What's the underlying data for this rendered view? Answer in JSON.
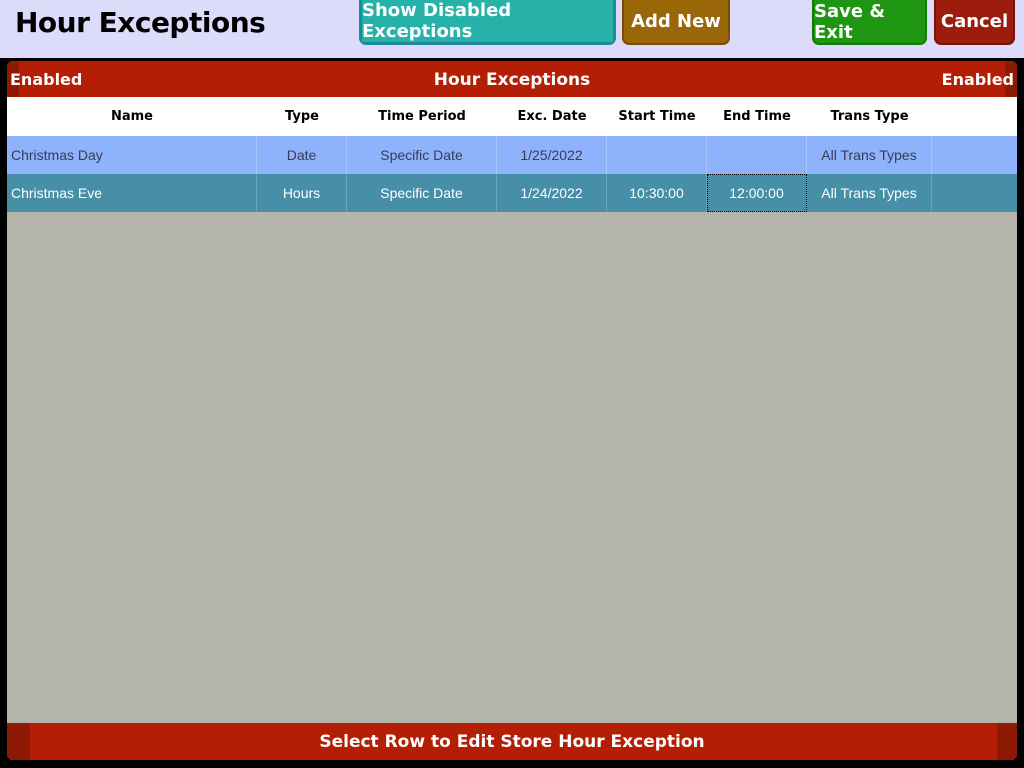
{
  "page_title": "Hour Exceptions",
  "toolbar": {
    "show_disabled_label": "Show Disabled Exceptions",
    "add_new_label": "Add New",
    "save_exit_label": "Save & Exit",
    "cancel_label": "Cancel"
  },
  "panel": {
    "title": "Hour Exceptions",
    "left_label": "Enabled",
    "right_label": "Enabled"
  },
  "table": {
    "columns": [
      "Name",
      "Type",
      "Time Period",
      "Exc. Date",
      "Start Time",
      "End Time",
      "Trans Type"
    ],
    "rows": [
      [
        "Christmas Day",
        "Date",
        "Specific Date",
        "1/25/2022",
        "",
        "",
        "All Trans Types"
      ],
      [
        "Christmas Eve",
        "Hours",
        "Specific Date",
        "1/24/2022",
        "10:30:00",
        "12:00:00",
        "All Trans Types"
      ]
    ]
  },
  "footer": {
    "message": "Select Row to Edit Store Hour Exception"
  },
  "colors": {
    "header_red": "#b31e05",
    "row_light_blue": "#8fb2fc",
    "row_selected_teal": "#468fa7",
    "panel_gray": "#b4b4ab"
  }
}
